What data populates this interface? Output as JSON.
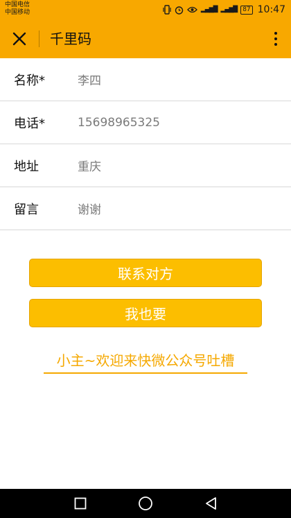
{
  "status_bar": {
    "carrier_1": "中国电信",
    "carrier_2": "中国移动",
    "battery": "87",
    "time": "10:47"
  },
  "toolbar": {
    "title": "千里码",
    "close_icon": "close-icon",
    "more_icon": "more-vertical-icon"
  },
  "form": {
    "rows": [
      {
        "label": "名称*",
        "value": "李四"
      },
      {
        "label": "电话*",
        "value": "15698965325"
      },
      {
        "label": "地址",
        "value": "重庆"
      },
      {
        "label": "留言",
        "value": "谢谢"
      }
    ]
  },
  "actions": {
    "contact_label": "联系对方",
    "want_label": "我也要",
    "feedback_link": "小主~欢迎来快微公众号吐槽"
  },
  "colors": {
    "accent": "#f8a800",
    "button": "#fcbe00",
    "link": "#f5a800"
  }
}
